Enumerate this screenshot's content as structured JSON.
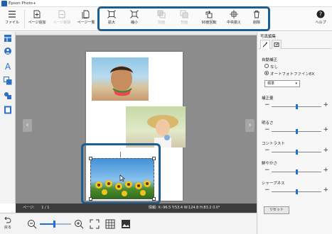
{
  "window": {
    "title": "Epson Photo+"
  },
  "toolbar": {
    "items": [
      {
        "label": "ファイル",
        "icon": "hamburger-menu-icon",
        "enabled": true
      },
      {
        "label": "ページ追加",
        "icon": "add-page-icon",
        "enabled": true
      },
      {
        "label": "ページ削除",
        "icon": "delete-page-icon",
        "enabled": false
      },
      {
        "label": "ページ一覧",
        "icon": "page-list-icon",
        "enabled": true
      },
      {
        "label": "拡大",
        "icon": "enlarge-icon",
        "enabled": true
      },
      {
        "label": "縮小",
        "icon": "shrink-icon",
        "enabled": true
      },
      {
        "label": "前面",
        "icon": "bring-front-icon",
        "enabled": false
      },
      {
        "label": "背面",
        "icon": "send-back-icon",
        "enabled": false
      },
      {
        "label": "90度回転",
        "icon": "rotate-90-icon",
        "enabled": true
      },
      {
        "label": "中央揃え",
        "icon": "center-align-icon",
        "enabled": true
      },
      {
        "label": "削除",
        "icon": "trash-icon",
        "enabled": true
      },
      {
        "label": "ヘルプ",
        "icon": "help-icon",
        "enabled": true
      }
    ]
  },
  "sidebar": {
    "icons": [
      "layout-icon",
      "people-icon",
      "text-icon",
      "frame-icon",
      "stamp-icon",
      "background-icon"
    ]
  },
  "statusbar": {
    "page_label": "ページ:",
    "page_value": "1 / 1",
    "info": "情報:   X:-96.5   Y:53.4   W:124.8   H:83.2   0.0°"
  },
  "bottombar": {
    "return_label": "戻る",
    "zoom_level": 0.45
  },
  "panel": {
    "title": "写真編集",
    "auto_correct_label": "自動補正",
    "option_none": "なし",
    "option_auto": "オートフォトファインEX",
    "auto_selected": "option_auto",
    "preset_value": "標準",
    "amount_label": "補正量",
    "sliders": [
      {
        "label": "明るさ",
        "value": 0.5
      },
      {
        "label": "コントラスト",
        "value": 0.5
      },
      {
        "label": "鮮やかさ",
        "value": 0.5
      },
      {
        "label": "シャープネス",
        "value": 0.5
      }
    ],
    "amount_value": 0.5,
    "reset_label": "リセット"
  },
  "colors": {
    "accent": "#1d6fd0",
    "highlight_border": "#1d5d91",
    "canvas_bg": "#8c8c8c",
    "statusbar_bg": "#3c3c3c"
  }
}
